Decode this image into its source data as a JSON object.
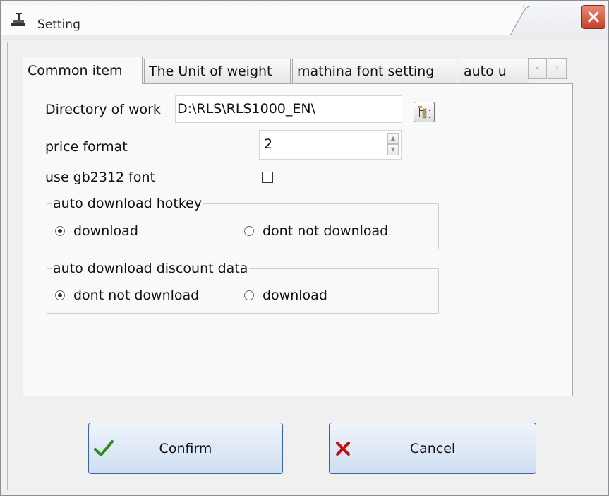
{
  "window": {
    "title": "Setting",
    "close_icon": "close-icon",
    "app_icon": "scale-icon",
    "accent": "#c6422b"
  },
  "tabs": [
    {
      "label": "Common item",
      "active": true
    },
    {
      "label": "The Unit of weight",
      "active": false
    },
    {
      "label": "mathina font setting",
      "active": false
    },
    {
      "label": "auto u",
      "active": false
    }
  ],
  "tab_scroll": {
    "left": "‹",
    "right": "›"
  },
  "form": {
    "directory_label": "Directory of work",
    "directory_value": "D:\\RLS\\RLS1000_EN\\",
    "price_format_label": "price format",
    "price_format_value": "2",
    "gb2312_label": "use gb2312 font",
    "gb2312_checked": false
  },
  "groups": {
    "hotkey": {
      "legend": "auto download hotkey",
      "options": [
        {
          "label": "download",
          "checked": true
        },
        {
          "label": "dont not download",
          "checked": false
        }
      ]
    },
    "discount": {
      "legend": "auto download discount data",
      "options": [
        {
          "label": "dont not download",
          "checked": true
        },
        {
          "label": "download",
          "checked": false
        }
      ]
    }
  },
  "buttons": {
    "confirm": "Confirm",
    "cancel": "Cancel",
    "confirm_color": "#2e8b20",
    "cancel_color": "#c01010"
  }
}
